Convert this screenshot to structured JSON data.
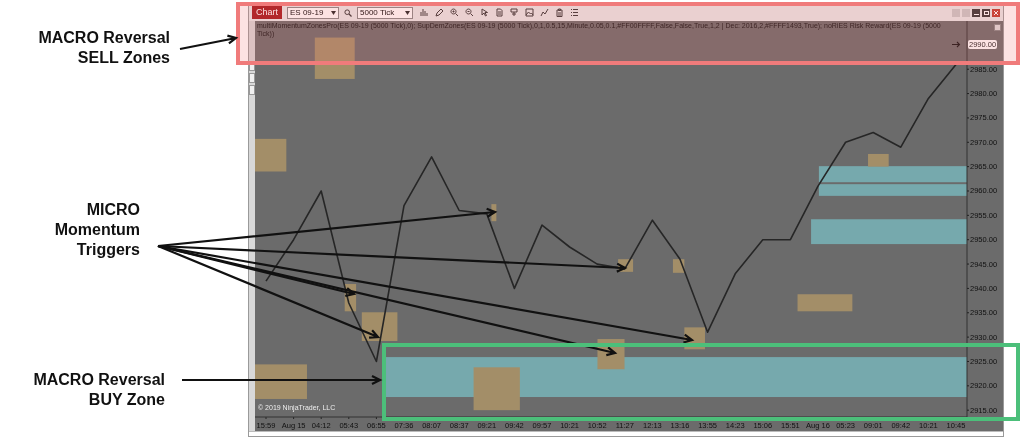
{
  "annotations": [
    {
      "kind": "sell",
      "lines": [
        "MACRO Reversal",
        "SELL Zones"
      ]
    },
    {
      "kind": "trigger",
      "lines": [
        "MICRO",
        "Momentum",
        "Triggers"
      ]
    },
    {
      "kind": "buy",
      "lines": [
        "MACRO Reversal",
        "BUY Zone"
      ]
    }
  ],
  "chart_window": {
    "title_button": "Chart",
    "instrument": "ES 09-19",
    "interval": "5000 Tick",
    "indicator_label": "multiMomentumZonesPro(ES 09-19 (5000 Tick),0); SupDemZones(ES 09-19 (5000 Tick),0,1,0.5,15,Minute,0.05,0.1,#FF00FFFF,False,False,True,1,2 | Dec: 2016,2,#FFFF1493,True); noRiES Risk Reward(ES 09-19 (5000 Tick))",
    "copyright": "© 2019 NinjaTrader, LLC",
    "price_marker": "2990.00",
    "zones": [
      {
        "color": "#76a9ad"
      },
      {
        "color": "#76a9ad"
      },
      {
        "color": "#76a9ad"
      },
      {
        "color": "#76a9ad"
      },
      {
        "color": "#a38e68"
      },
      {
        "color": "#a38e68"
      },
      {
        "color": "#a38e68"
      },
      {
        "color": "#a38e68"
      },
      {
        "color": "#a38e68"
      },
      {
        "color": "#a38e68"
      },
      {
        "color": "#a38e68"
      },
      {
        "color": "#a38e68"
      },
      {
        "color": "#a38e68"
      },
      {
        "color": "#a38e68"
      },
      {
        "color": "#a38e68"
      },
      {
        "color": "#a38e68"
      },
      {
        "color": "#a38e68"
      }
    ],
    "chart_data": {
      "type": "line",
      "categories": [
        "15:59",
        "Aug 15",
        "04:12",
        "05:43",
        "06:55",
        "07:36",
        "08:07",
        "08:37",
        "09:21",
        "09:42",
        "09:57",
        "10:21",
        "10:52",
        "11:27",
        "12:13",
        "13:16",
        "13:55",
        "14:23",
        "15:06",
        "15:51",
        "Aug 16",
        "05:23",
        "09:01",
        "09:42",
        "10:21",
        "10:45"
      ],
      "values": [
        2941.5,
        2950,
        2960,
        2937,
        2925,
        2957,
        2967,
        2956,
        2955.3,
        2940,
        2953,
        2948.5,
        2945,
        2944,
        2954,
        2946,
        2931,
        2943,
        2950,
        2950,
        2961,
        2970,
        2972,
        2969,
        2979,
        2986
      ],
      "ylim": [
        2913.6,
        2994.9
      ],
      "yticks": [
        {
          "value": 2915,
          "label": "2915.00"
        },
        {
          "value": 2920,
          "label": "2920.00"
        },
        {
          "value": 2925,
          "label": "2925.00"
        },
        {
          "value": 2930,
          "label": "2930.00"
        },
        {
          "value": 2935,
          "label": "2935.00"
        },
        {
          "value": 2940,
          "label": "2940.00"
        },
        {
          "value": 2945,
          "label": "2945.00"
        },
        {
          "value": 2950,
          "label": "2950.00"
        },
        {
          "value": 2955,
          "label": "2955.00"
        },
        {
          "value": 2960,
          "label": "2960.00"
        },
        {
          "value": 2965,
          "label": "2965.00"
        },
        {
          "value": 2970,
          "label": "2970.00"
        },
        {
          "value": 2975,
          "label": "2975.00"
        },
        {
          "value": 2980,
          "label": "2980.00"
        },
        {
          "value": 2985,
          "label": "2985.00"
        }
      ]
    }
  }
}
